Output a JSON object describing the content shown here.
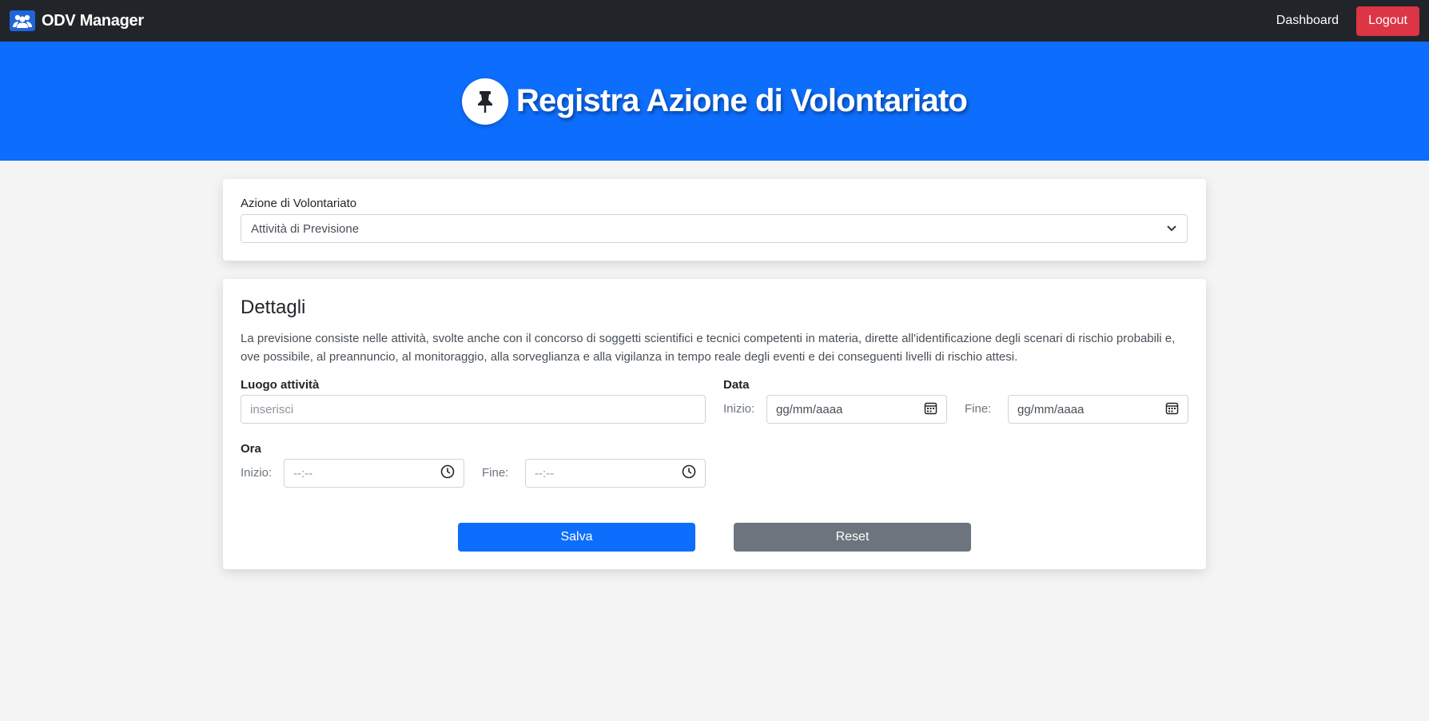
{
  "navbar": {
    "brand": "ODV Manager",
    "dashboard_link": "Dashboard",
    "logout_label": "Logout"
  },
  "hero": {
    "title": "Registra Azione di Volontariato",
    "icon": "pushpin-icon"
  },
  "action_card": {
    "label": "Azione di Volontariato",
    "selected_value": "Attività di Previsione"
  },
  "details": {
    "title": "Dettagli",
    "description": "La previsione consiste nelle attività, svolte anche con il concorso di soggetti scientifici e tecnici competenti in materia, dirette all'identificazione degli scenari di rischio probabili e, ove possibile, al preannuncio, al monitoraggio, alla sorveglianza e alla vigilanza in tempo reale degli eventi e dei conseguenti livelli di rischio attesi.",
    "location": {
      "label": "Luogo attività",
      "placeholder": "inserisci"
    },
    "date": {
      "label": "Data",
      "start_label": "Inizio:",
      "end_label": "Fine:",
      "start_placeholder": "gg/mm/aaaa",
      "end_placeholder": "gg/mm/aaaa"
    },
    "time": {
      "label": "Ora",
      "start_label": "Inizio:",
      "end_label": "Fine:",
      "start_placeholder": "--:--",
      "end_placeholder": "--:--"
    },
    "save_label": "Salva",
    "reset_label": "Reset"
  },
  "colors": {
    "primary": "#0d6efd",
    "danger": "#dc3545",
    "secondary": "#6c757d",
    "navbar": "#212529"
  }
}
